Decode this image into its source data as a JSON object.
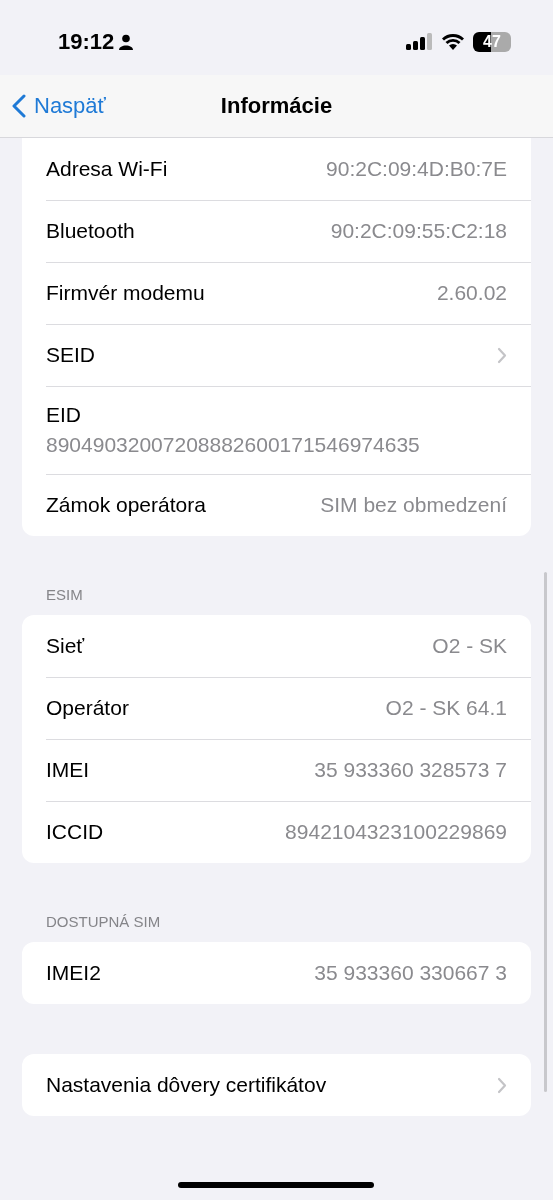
{
  "status_bar": {
    "time": "19:12",
    "battery": "47"
  },
  "nav": {
    "back": "Naspäť",
    "title": "Informácie"
  },
  "sections": [
    {
      "rows": [
        {
          "kind": "value",
          "label": "Adresa Wi-Fi",
          "value": "90:2C:09:4D:B0:7E"
        },
        {
          "kind": "value",
          "label": "Bluetooth",
          "value": "90:2C:09:55:C2:18"
        },
        {
          "kind": "value",
          "label": "Firmvér modemu",
          "value": "2.60.02"
        },
        {
          "kind": "disclosure",
          "label": "SEID"
        },
        {
          "kind": "stacked",
          "label": "EID",
          "value": "89049032007208882600171546974635"
        },
        {
          "kind": "value",
          "label": "Zámok operátora",
          "value": "SIM bez obmedzení"
        }
      ]
    },
    {
      "header": "ESIM",
      "rows": [
        {
          "kind": "value",
          "label": "Sieť",
          "value": "O2 - SK"
        },
        {
          "kind": "value",
          "label": "Operátor",
          "value": "O2 - SK 64.1"
        },
        {
          "kind": "value",
          "label": "IMEI",
          "value": "35 933360 328573 7"
        },
        {
          "kind": "value",
          "label": "ICCID",
          "value": "8942104323100229869"
        }
      ]
    },
    {
      "header": "DOSTUPNÁ SIM",
      "rows": [
        {
          "kind": "value",
          "label": "IMEI2",
          "value": "35 933360 330667 3"
        }
      ]
    },
    {
      "rows": [
        {
          "kind": "disclosure",
          "label": "Nastavenia dôvery certifikátov"
        }
      ]
    }
  ]
}
